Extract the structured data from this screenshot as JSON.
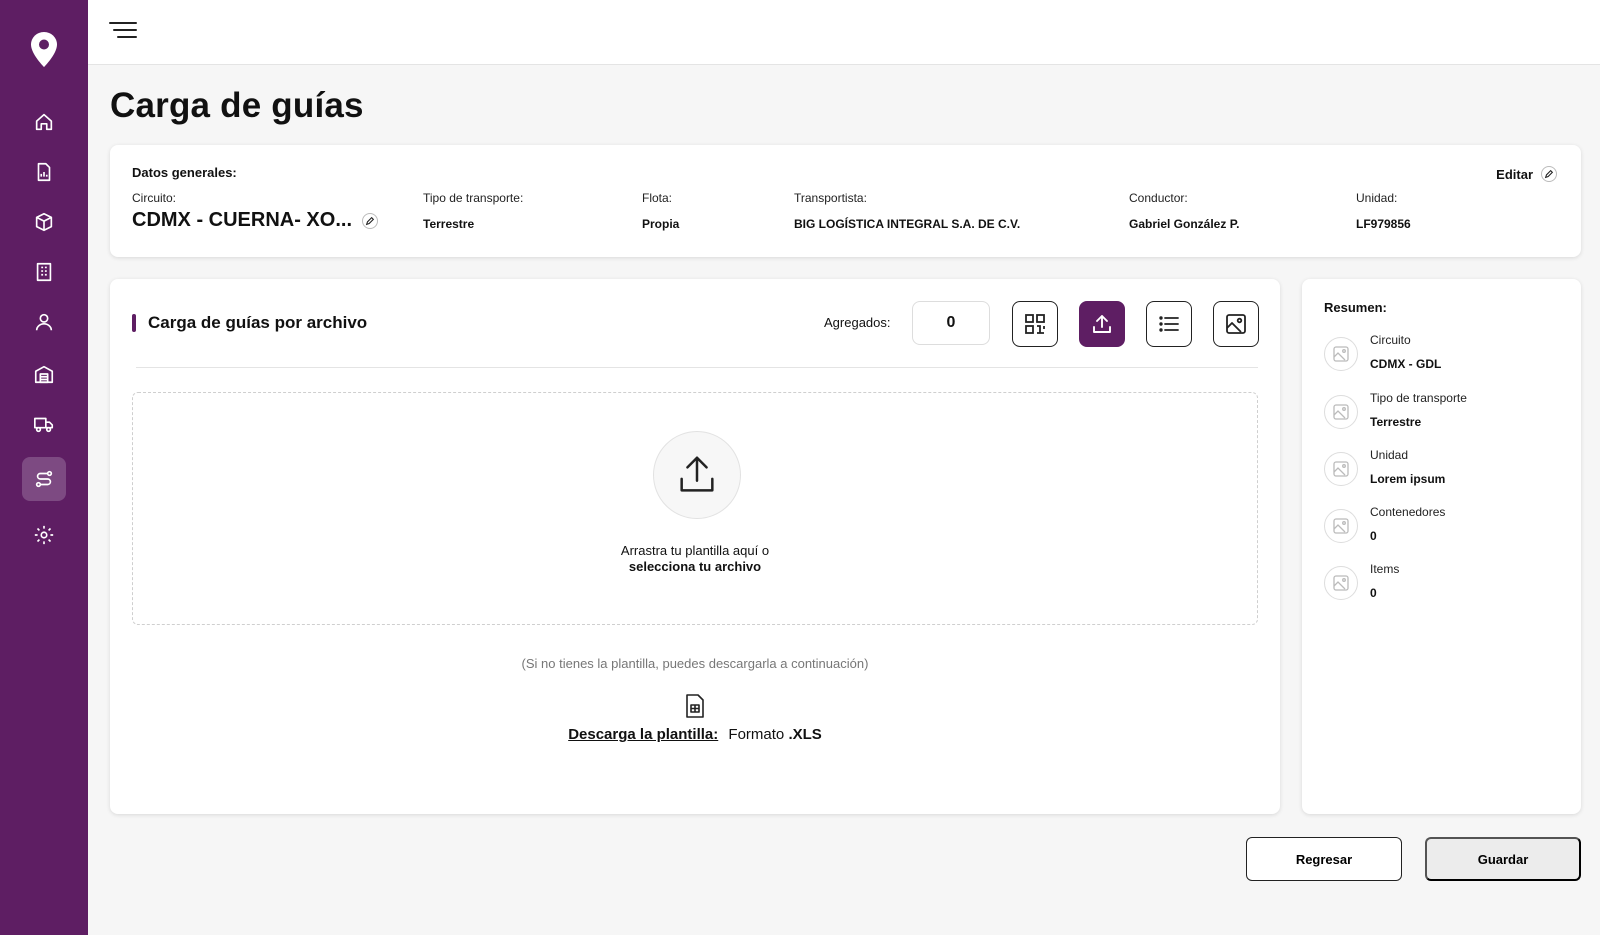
{
  "sidebar": {
    "logo_icon": "location-pin-icon",
    "items": [
      {
        "icon": "home-icon"
      },
      {
        "icon": "document-icon"
      },
      {
        "icon": "box-icon"
      },
      {
        "icon": "building-icon"
      },
      {
        "icon": "user-icon"
      },
      {
        "icon": "warehouse-icon"
      },
      {
        "icon": "truck-icon"
      },
      {
        "icon": "route-icon",
        "active": true
      },
      {
        "icon": "gear-icon"
      }
    ],
    "accent": "#5e1e63"
  },
  "page": {
    "title": "Carga de guías"
  },
  "general": {
    "title": "Datos generales:",
    "edit_label": "Editar",
    "fields": {
      "circuito": {
        "label": "Circuito:",
        "value": "CDMX - CUERNA- XO..."
      },
      "tipo": {
        "label": "Tipo de transporte:",
        "value": "Terrestre"
      },
      "flota": {
        "label": "Flota:",
        "value": "Propia"
      },
      "transportista": {
        "label": "Transportista:",
        "value": "BIG LOGÍSTICA INTEGRAL S.A. DE C.V."
      },
      "conductor": {
        "label": "Conductor:",
        "value": "Gabriel González P."
      },
      "unidad": {
        "label": "Unidad:",
        "value": "LF979856"
      }
    }
  },
  "upload": {
    "title": "Carga de guías por archivo",
    "agregados_label": "Agregados:",
    "agregados_value": "0",
    "tools": [
      "qr-code-icon",
      "upload-icon",
      "list-icon",
      "image-icon"
    ],
    "active_tool": "upload-icon",
    "dropzone_text": "Arrastra tu plantilla aquí o",
    "dropzone_link": "selecciona tu archivo",
    "hint": "(Si no tienes la plantilla, puedes descargarla a continuación)",
    "download_link": "Descarga la plantilla:",
    "format_prefix": "Formato",
    "format_ext": ".XLS"
  },
  "summary": {
    "title": "Resumen:",
    "items": [
      {
        "label": "Circuito",
        "value": "CDMX - GDL"
      },
      {
        "label": "Tipo de transporte",
        "value": "Terrestre"
      },
      {
        "label": "Unidad",
        "value": "Lorem ipsum"
      },
      {
        "label": "Contenedores",
        "value": "0"
      },
      {
        "label": "Items",
        "value": "0"
      }
    ]
  },
  "footer": {
    "back_label": "Regresar",
    "save_label": "Guardar"
  }
}
